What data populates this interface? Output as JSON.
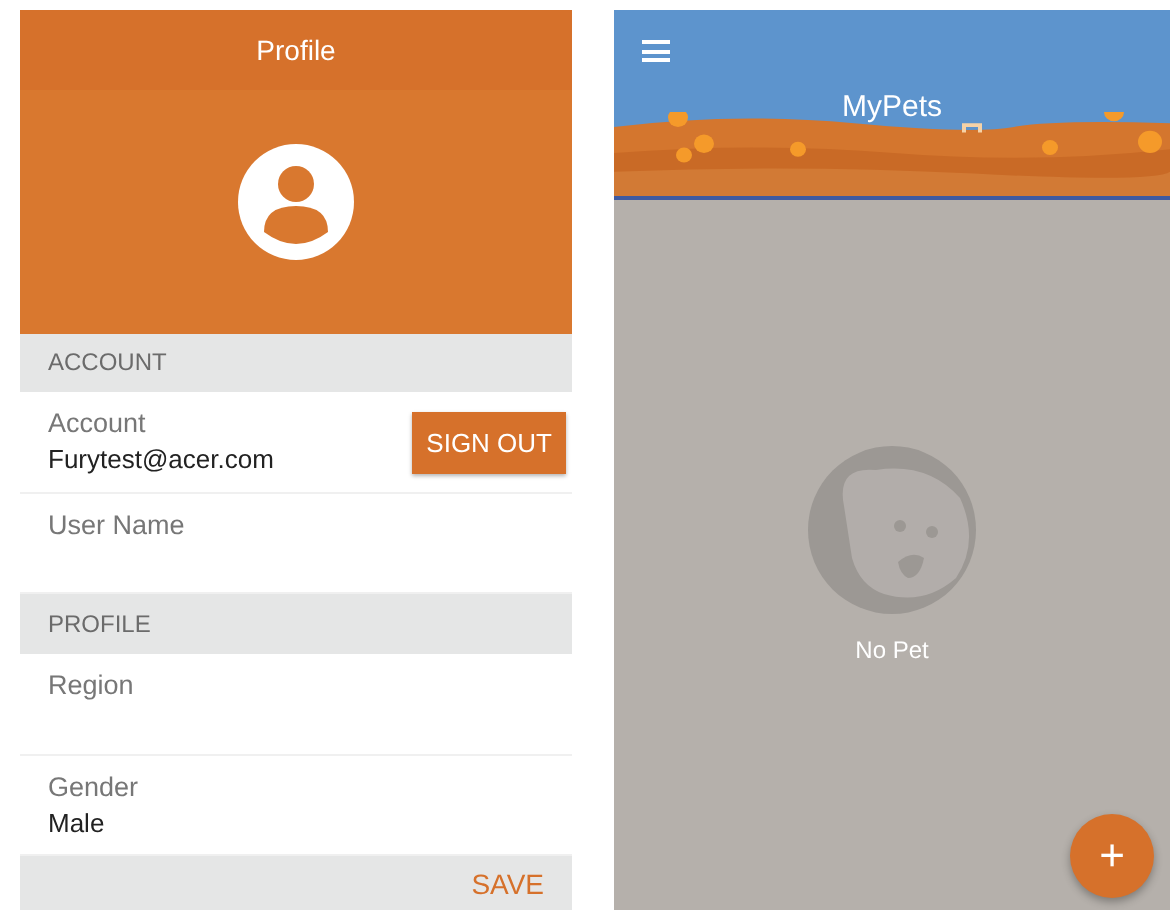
{
  "profile_screen": {
    "title": "Profile",
    "sections": [
      {
        "heading": "ACCOUNT",
        "rows": [
          {
            "label": "Account",
            "value": "Furytest@acer.com",
            "button": "SIGN OUT"
          },
          {
            "label": "User Name"
          }
        ]
      },
      {
        "heading": "PROFILE",
        "rows": [
          {
            "label": "Region"
          },
          {
            "label": "Gender",
            "value": "Male"
          }
        ]
      }
    ],
    "save_button": "SAVE"
  },
  "pets_screen": {
    "title": "MyPets",
    "empty_message": "No Pet",
    "add_button": "+"
  }
}
